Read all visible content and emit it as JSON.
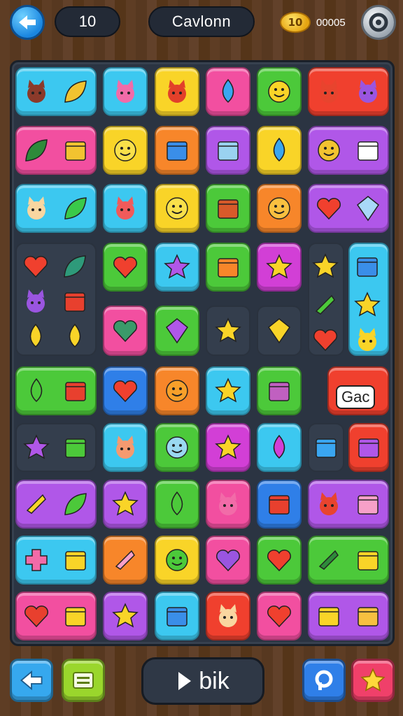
{
  "top_bar": {
    "back_icon": "back-arrow-icon",
    "moves_value": "10",
    "title": "Cavlonn",
    "coin_badge": "10",
    "coins_value": "00005",
    "settings_icon": "gear-icon"
  },
  "board": {
    "special_tile_label": "Gac"
  },
  "bottom_bar": {
    "left_button_icon": "back-arrow-icon",
    "menu_button_icon": "menu-lines-icon",
    "main_button_label": "bik",
    "search_button_icon": "search-icon",
    "star_button_icon": "star-icon"
  },
  "colors": {
    "board": "#2b3442",
    "cyan": "#3cc8f0",
    "pink": "#f24fa0",
    "yellow": "#f9d428",
    "green": "#4cc93a",
    "orange": "#f7862a",
    "purple": "#b057e8",
    "red": "#f0402e",
    "blue": "#2f7fe8",
    "magenta": "#d23fd6",
    "lime": "#9ad62c"
  }
}
